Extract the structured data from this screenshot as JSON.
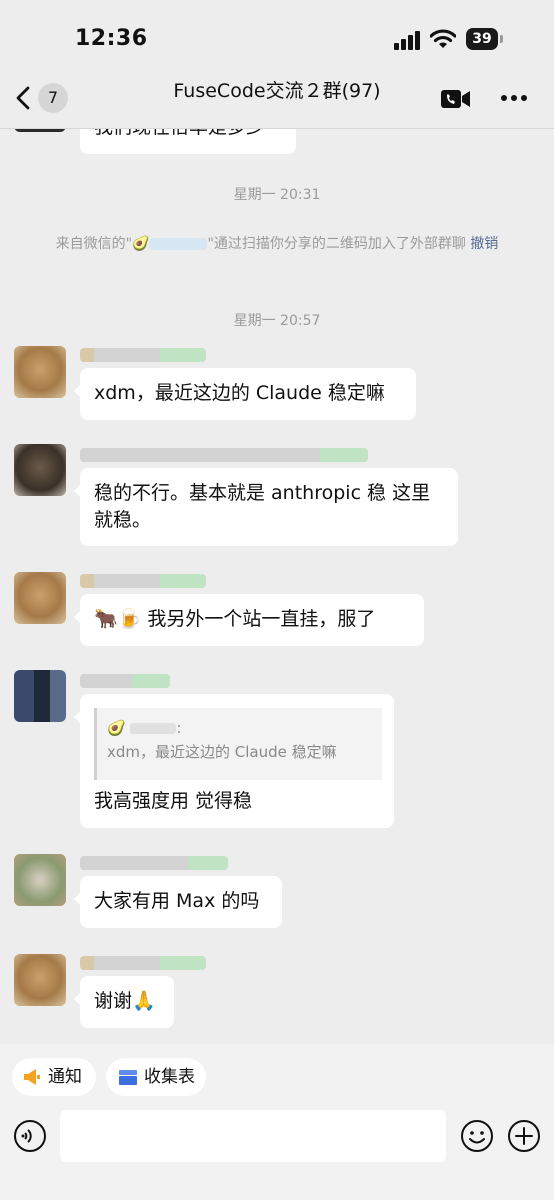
{
  "status_bar": {
    "time": "12:36",
    "battery": "39"
  },
  "nav": {
    "unread_count": "7",
    "title": "FuseCode交流２群(97)"
  },
  "messages": {
    "top_partial": "我们现在倍率是多少",
    "time_1": "星期一 20:31",
    "system_prefix": "来自微信的\"🥑",
    "system_suffix": "\"通过扫描你分享的二维码加入了外部群聊",
    "system_revoke": "撤销",
    "time_2": "星期一 20:57",
    "msg1": "xdm，最近这边的 Claude 稳定嘛",
    "msg2": "稳的不行。基本就是 anthropic 稳 这里就稳。",
    "msg3": "🐂🍺 我另外一个站一直挂，服了",
    "quote_prefix": "🥑",
    "quote_suffix": ":",
    "quote_text": "xdm，最近这边的 Claude 稳定嘛",
    "msg4": "我高强度用 觉得稳",
    "msg5": "大家有用 Max 的吗",
    "msg6": "谢谢🙏"
  },
  "quick_actions": {
    "notice": "通知",
    "form": "收集表"
  },
  "input": {
    "placeholder": ""
  },
  "colors": {
    "background": "#ededed",
    "bubble": "#ffffff",
    "link": "#576b95",
    "muted": "#9b9b9b"
  }
}
